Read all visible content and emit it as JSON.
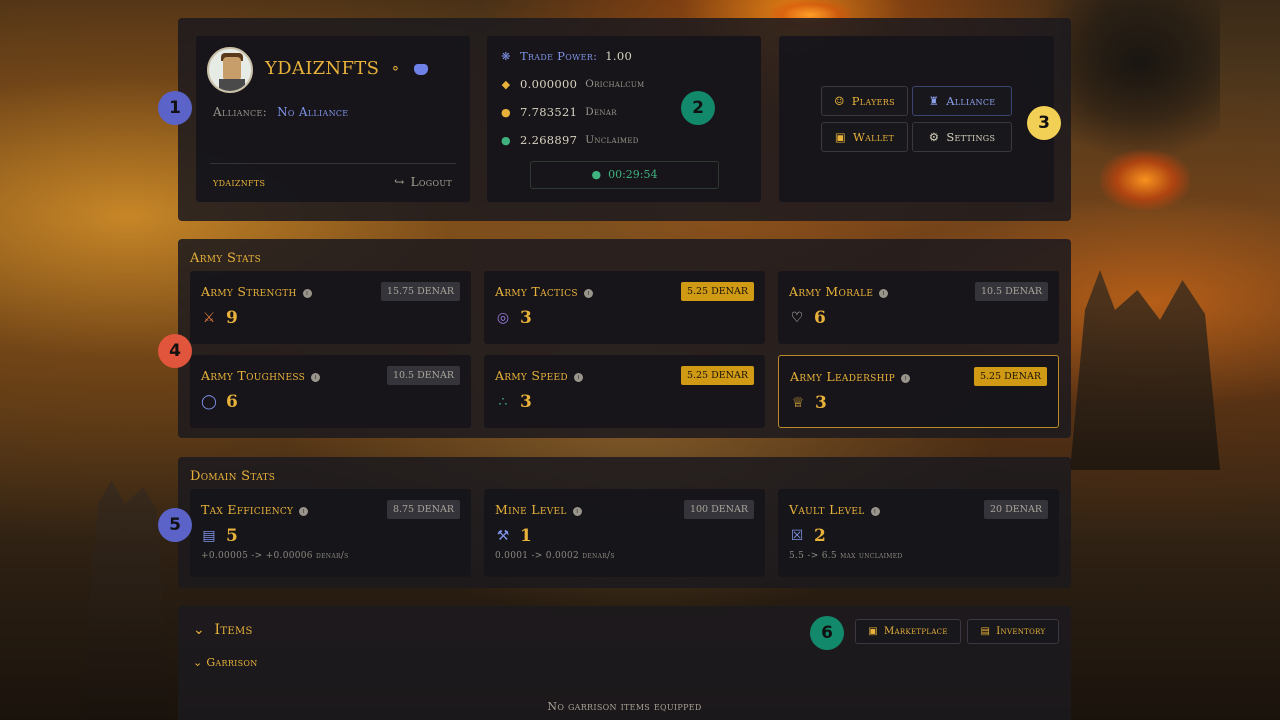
{
  "profile": {
    "username": "YDAIZNFTS",
    "alliance_label": "Alliance:",
    "alliance_value": "No Alliance",
    "footer_user": "ydaiznfts",
    "logout_label": "Logout"
  },
  "trade": {
    "power_label": "Trade Power:",
    "power_value": "1.00",
    "orichalcum_value": "0.000000",
    "orichalcum_unit": "Orichalcum",
    "denar_value": "7.783521",
    "denar_unit": "Denar",
    "unclaimed_value": "2.268897",
    "unclaimed_unit": "Unclaimed",
    "timer": "00:29:54"
  },
  "actions": {
    "players": "Players",
    "alliance": "Alliance",
    "wallet": "Wallet",
    "settings": "Settings"
  },
  "badges": [
    "1",
    "2",
    "3",
    "4",
    "5",
    "6"
  ],
  "army": {
    "title": "Army Stats",
    "stats": [
      {
        "name": "Army Strength",
        "cost": "15.75 DENAR",
        "value": "9",
        "icon": "sword-icon"
      },
      {
        "name": "Army Tactics",
        "cost": "5.25 DENAR",
        "value": "3",
        "icon": "target-icon"
      },
      {
        "name": "Army Morale",
        "cost": "10.5 DENAR",
        "value": "6",
        "icon": "heart-icon"
      },
      {
        "name": "Army Toughness",
        "cost": "10.5 DENAR",
        "value": "6",
        "icon": "shield-icon"
      },
      {
        "name": "Army Speed",
        "cost": "5.25 DENAR",
        "value": "3",
        "icon": "footprints-icon"
      },
      {
        "name": "Army Leadership",
        "cost": "5.25 DENAR",
        "value": "3",
        "icon": "crown-icon"
      }
    ]
  },
  "domain": {
    "title": "Domain Stats",
    "stats": [
      {
        "name": "Tax Efficiency",
        "cost": "8.75 DENAR",
        "value": "5",
        "sub": "+0.00005 -> +0.00006 denar/s",
        "icon": "book-icon"
      },
      {
        "name": "Mine Level",
        "cost": "100 DENAR",
        "value": "1",
        "sub": "0.0001 -> 0.0002 denar/s",
        "icon": "pickaxe-icon"
      },
      {
        "name": "Vault Level",
        "cost": "20 DENAR",
        "value": "2",
        "sub": "5.5 -> 6.5 max unclaimed",
        "icon": "vault-icon"
      }
    ]
  },
  "items": {
    "title": "Items",
    "marketplace": "Marketplace",
    "inventory": "Inventory",
    "garrison": "Garrison",
    "empty_message": "No garrison items equipped"
  },
  "colors": {
    "accent_gold": "#e8b23a",
    "accent_blue": "#7f93e8",
    "accent_green": "#3fb27f",
    "cost_highlight": "#d19a14"
  }
}
